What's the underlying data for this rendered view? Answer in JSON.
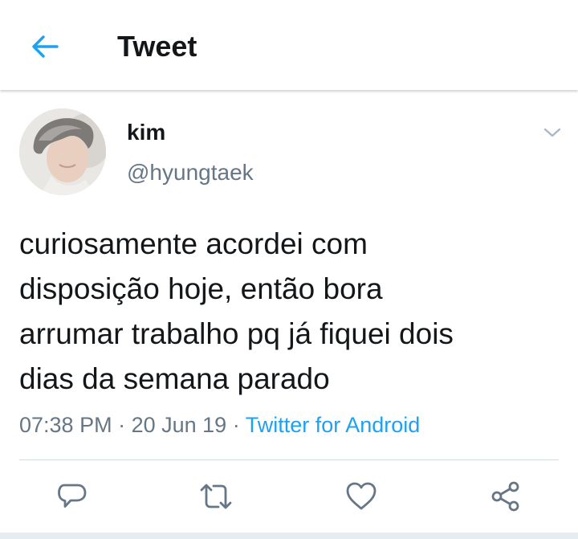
{
  "header": {
    "title": "Tweet",
    "back_icon": "arrow-left-icon"
  },
  "tweet": {
    "author": {
      "display_name": "kim",
      "handle": "@hyungtaek"
    },
    "text": "curiosamente acordei com\ndisposição hoje, então bora\narrumar trabalho pq já fiquei dois\ndias da semana parado",
    "time": "07:38 PM",
    "date": "20 Jun 19",
    "separator": " · ",
    "source": "Twitter for Android"
  },
  "actions": [
    {
      "name": "reply",
      "icon": "reply-icon"
    },
    {
      "name": "retweet",
      "icon": "retweet-icon"
    },
    {
      "name": "like",
      "icon": "heart-icon"
    },
    {
      "name": "share",
      "icon": "share-icon"
    }
  ],
  "colors": {
    "accent": "#1da1f2",
    "text": "#14171a",
    "secondary": "#657786",
    "divider": "#d5dde3"
  }
}
